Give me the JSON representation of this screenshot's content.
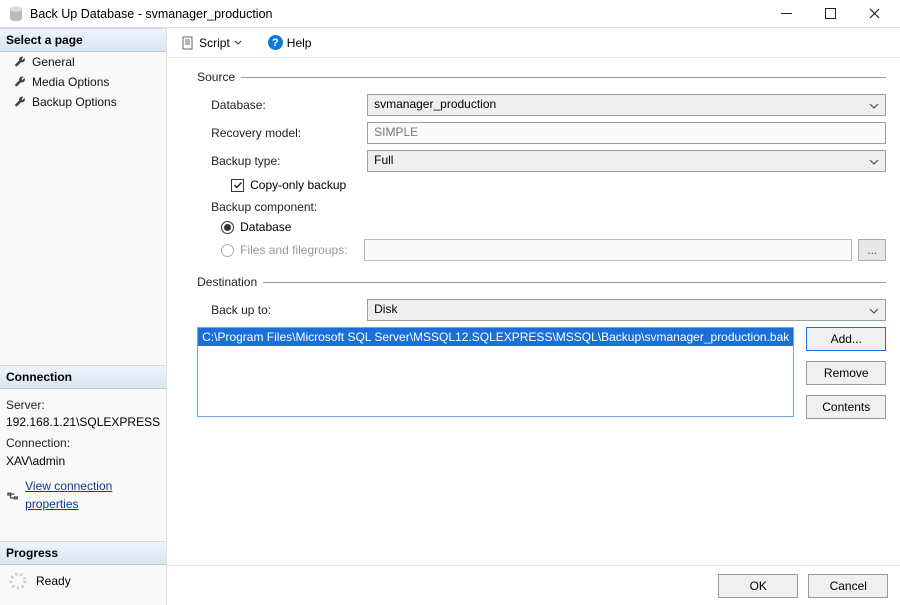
{
  "window": {
    "title": "Back Up Database - svmanager_production"
  },
  "sidebar": {
    "select_hdr": "Select a page",
    "items": [
      {
        "label": "General"
      },
      {
        "label": "Media Options"
      },
      {
        "label": "Backup Options"
      }
    ],
    "connection_hdr": "Connection",
    "server_label": "Server:",
    "server_value": "192.168.1.21\\SQLEXPRESS",
    "connection_label": "Connection:",
    "connection_value": "XAV\\admin",
    "view_conn_link": "View connection properties",
    "progress_hdr": "Progress",
    "progress_status": "Ready"
  },
  "toolbar": {
    "script_label": "Script",
    "help_label": "Help"
  },
  "form": {
    "source_hdr": "Source",
    "database_label": "Database:",
    "database_value": "svmanager_production",
    "recovery_label": "Recovery model:",
    "recovery_value": "SIMPLE",
    "backup_type_label": "Backup type:",
    "backup_type_value": "Full",
    "copy_only_label": "Copy-only backup",
    "component_label": "Backup component:",
    "component_db": "Database",
    "component_fg": "Files and filegroups:",
    "ellipsis": "...",
    "destination_hdr": "Destination",
    "backup_to_label": "Back up to:",
    "backup_to_value": "Disk",
    "dest_path": "C:\\Program Files\\Microsoft SQL Server\\MSSQL12.SQLEXPRESS\\MSSQL\\Backup\\svmanager_production.bak",
    "add_btn": "Add...",
    "remove_btn": "Remove",
    "contents_btn": "Contents"
  },
  "footer": {
    "ok": "OK",
    "cancel": "Cancel"
  }
}
